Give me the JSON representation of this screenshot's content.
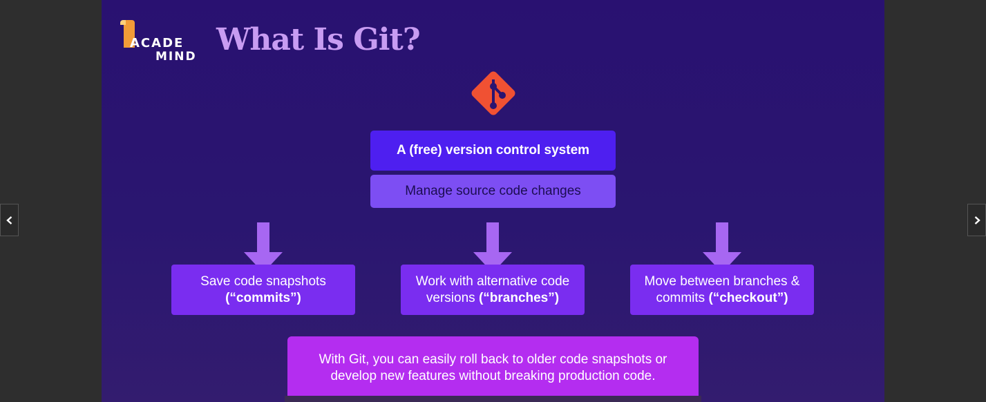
{
  "nav": {
    "prev_icon": "chevron-left-icon",
    "next_icon": "chevron-right-icon"
  },
  "logo": {
    "line1": "ACADE",
    "line2": "MIND"
  },
  "title": "What Is Git?",
  "main_box": "A (free) version control system",
  "sub_box": "Manage source code changes",
  "cards": [
    {
      "line1": "Save code snapshots",
      "line2_plain": "",
      "line2_bold": "(“commits”)"
    },
    {
      "line1": "Work with alternative code",
      "line2_plain": "versions ",
      "line2_bold": "(“branches”)"
    },
    {
      "line1": "Move between branches &",
      "line2_plain": "commits ",
      "line2_bold": "(“checkout”)"
    }
  ],
  "bottom": {
    "line1": "With Git, you can easily roll back to older code snapshots or",
    "line2": "develop new features without breaking production code."
  },
  "colors": {
    "title": "#c89cf2",
    "main_box": "#4e1ff0",
    "sub_box": "#7d4ef3",
    "card": "#7a2df0",
    "arrow": "#a767f2",
    "bottom_box": "#b42df0",
    "git_logo": "#f05133"
  }
}
